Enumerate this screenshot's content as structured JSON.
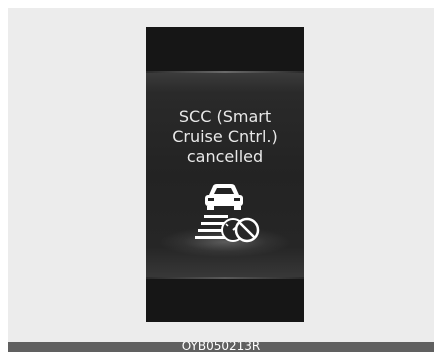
{
  "display": {
    "message_lines": [
      "SCC (Smart",
      "Cruise Cntrl.)",
      "cancelled"
    ]
  },
  "icons": {
    "status_icon": "scc-cancelled-icon"
  },
  "caption": {
    "code": "OYB050213R"
  },
  "colors": {
    "screen_background": "#161616",
    "text": "#e8e8e8",
    "panel_background": "#ececec",
    "caption_bar": "#606060"
  }
}
